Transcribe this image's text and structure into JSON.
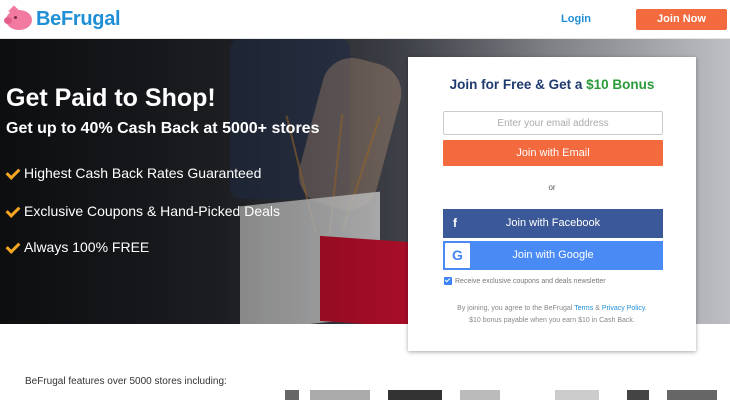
{
  "header": {
    "logo_text": "BeFrugal",
    "login_label": "Login",
    "join_label": "Join Now"
  },
  "hero": {
    "title": "Get Paid to Shop!",
    "subtitle": "Get up to 40% Cash Back at 5000+ stores",
    "benefits": [
      "Highest Cash Back Rates Guaranteed",
      "Exclusive Coupons & Hand-Picked Deals",
      "Always 100% FREE"
    ]
  },
  "signup": {
    "title_prefix": "Join for Free & Get a ",
    "title_bonus": "$10 Bonus",
    "email_placeholder": "Enter your email address",
    "email_button": "Join with Email",
    "or_text": "or",
    "facebook_button": "Join with Facebook",
    "google_button": "Join with Google",
    "newsletter_label": "Receive exclusive coupons and deals newsletter",
    "newsletter_checked": true,
    "terms_prefix": "By joining, you agree to the BeFrugal ",
    "terms_link": "Terms",
    "terms_and": " & ",
    "privacy_link": "Privacy Policy",
    "terms_suffix": ".",
    "bonus_note": "$10 bonus payable when you earn $10 in Cash Back."
  },
  "features": {
    "text": "BeFrugal features over 5000 stores including:"
  },
  "colors": {
    "brand_blue": "#1f8fd6",
    "brand_orange": "#f26a3d",
    "facebook": "#3b5998",
    "google": "#4a8af4",
    "bonus_green": "#2a9a3a"
  }
}
